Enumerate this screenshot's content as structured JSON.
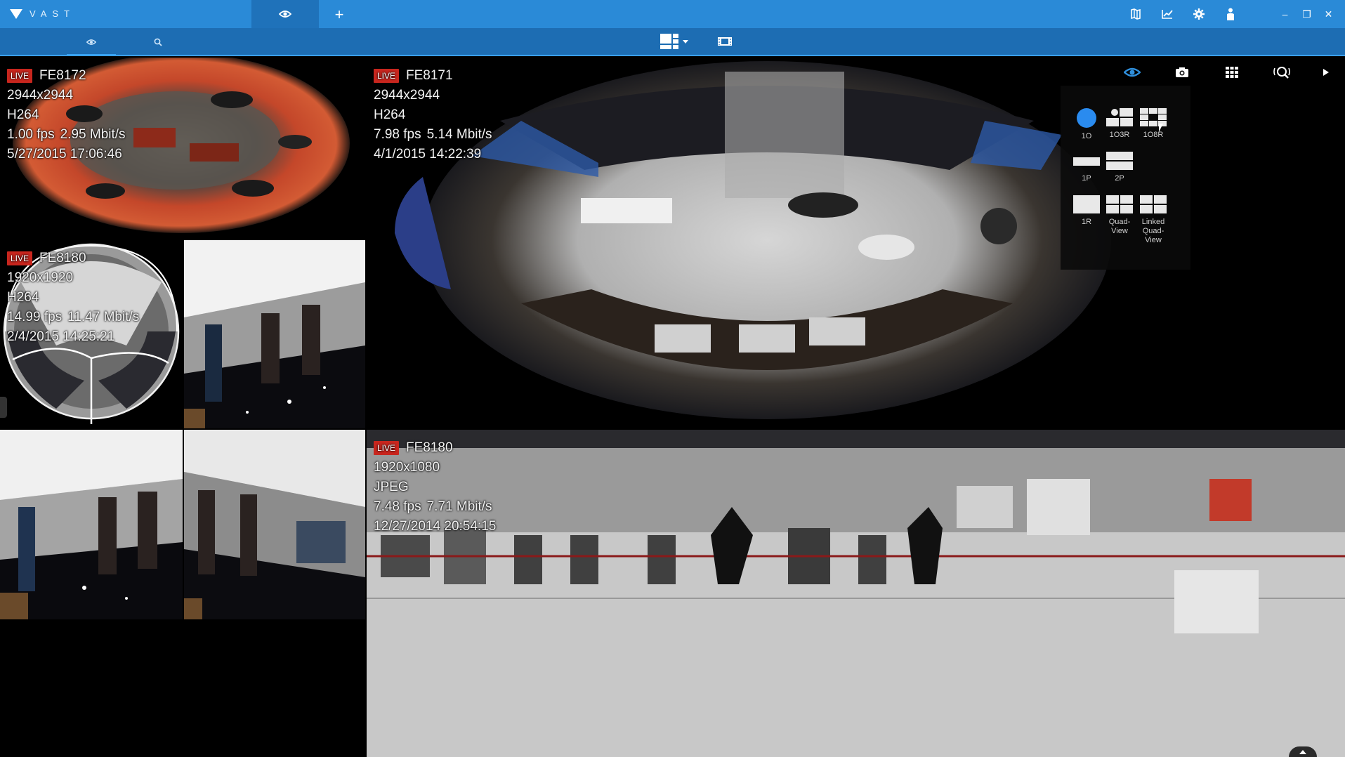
{
  "app": {
    "brand": "VAST"
  },
  "titlebar": {
    "add_tab_label": "+",
    "icons": [
      "map-icon",
      "chart-icon",
      "gear-icon",
      "user-icon"
    ],
    "window": {
      "minimize": "–",
      "restore": "❐",
      "close": "✕"
    }
  },
  "toolbar": {
    "side_tabs": [
      "eye-icon",
      "search-icon"
    ],
    "layout_icon": "layout-grid-icon",
    "film_icon": "film-strip-icon"
  },
  "cells": {
    "top_left": {
      "live": "LIVE",
      "name": "FE8172",
      "resolution": "2944x2944",
      "codec": "H264",
      "fps": "1.00 fps",
      "bitrate": "2.95 Mbit/s",
      "timestamp": "5/27/2015 17:06:46"
    },
    "mid_left": {
      "live": "LIVE",
      "name": "FE8180",
      "resolution": "1920x1920",
      "codec": "H264",
      "fps": "14.99 fps",
      "bitrate": "11.47 Mbit/s",
      "timestamp": "2/4/2015 14:25:21"
    },
    "main": {
      "live": "LIVE",
      "name": "FE8171",
      "resolution": "2944x2944",
      "codec": "H264",
      "fps": "7.98 fps",
      "bitrate": "5.14 Mbit/s",
      "timestamp": "4/1/2015 14:22:39"
    },
    "bottom_right": {
      "live": "LIVE",
      "name": "FE8180",
      "resolution": "1920x1080",
      "codec": "JPEG",
      "fps": "7.48 fps",
      "bitrate": "7.71 Mbit/s",
      "timestamp": "12/27/2014 20:54:15"
    }
  },
  "main_tools": [
    "fisheye-eye-icon",
    "camera-icon",
    "grid-icon",
    "ptz-search-icon",
    "play-icon"
  ],
  "dewarp_menu": {
    "items": [
      {
        "label": "1O"
      },
      {
        "label": "1O3R"
      },
      {
        "label": "1O8R"
      },
      {
        "label": "1P"
      },
      {
        "label": "2P"
      },
      {
        "label": "1R"
      },
      {
        "label": "Quad-View"
      },
      {
        "label": "Linked Quad-View"
      }
    ],
    "selected": "1O",
    "accent": "#2a8bef"
  },
  "colors": {
    "titlebar": "#2a8ad7",
    "toolbar": "#1d6db3",
    "live_badge": "#c8261e",
    "selection": "#2f8fdc"
  }
}
